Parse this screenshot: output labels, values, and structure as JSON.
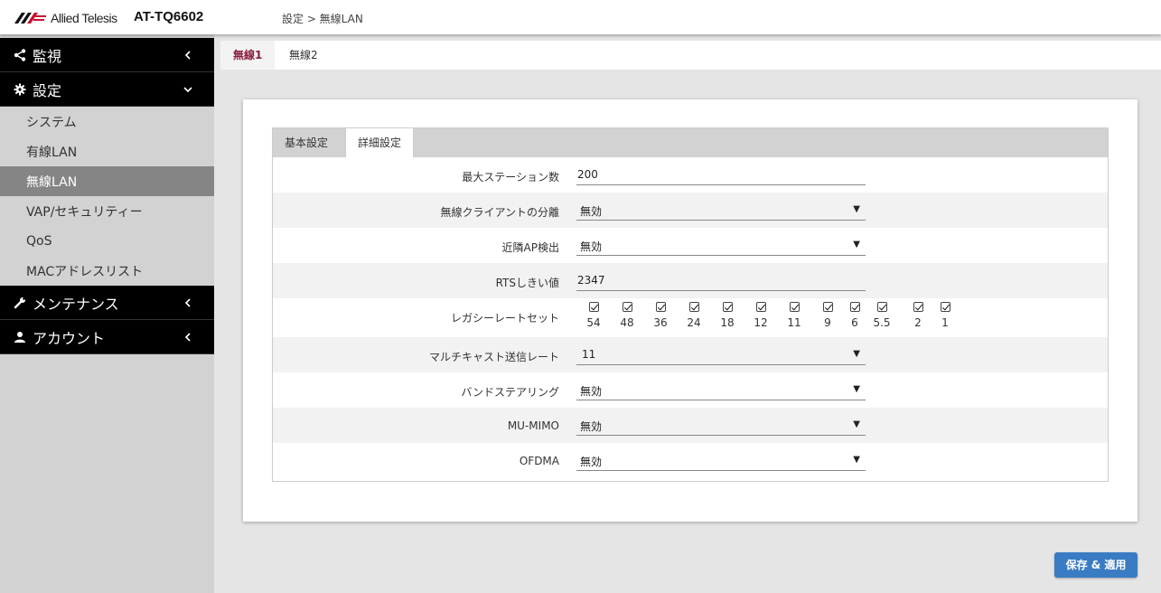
{
  "header": {
    "logo_text": "Allied Telesis",
    "model": "AT-TQ6602",
    "breadcrumb": "設定 > 無線LAN"
  },
  "sidebar": {
    "groups": [
      {
        "label": "監視",
        "icon": "share-icon",
        "chevron": "chevron-left-icon"
      },
      {
        "label": "設定",
        "icon": "gear-icon",
        "chevron": "chevron-down-icon"
      },
      {
        "label": "メンテナンス",
        "icon": "wrench-icon",
        "chevron": "chevron-left-icon"
      },
      {
        "label": "アカウント",
        "icon": "user-icon",
        "chevron": "chevron-left-icon"
      }
    ],
    "settings_items": [
      "システム",
      "有線LAN",
      "無線LAN",
      "VAP/セキュリティー",
      "QoS",
      "MACアドレスリスト"
    ],
    "active_item": "無線LAN"
  },
  "top_tabs": [
    "無線1",
    "無線2"
  ],
  "inner_tabs": [
    "基本設定",
    "詳細設定"
  ],
  "form": {
    "max_stations": {
      "label": "最大ステーション数",
      "value": "200"
    },
    "client_isolation": {
      "label": "無線クライアントの分離",
      "value": "無効"
    },
    "neighbor_ap": {
      "label": "近隣AP検出",
      "value": "無効"
    },
    "rts": {
      "label": "RTSしきい値",
      "value": "2347"
    },
    "legacy_rates": {
      "label": "レガシーレートセット",
      "rates": [
        "54",
        "48",
        "36",
        "24",
        "18",
        "12",
        "11",
        "9",
        "6",
        "5.5",
        "2",
        "1"
      ],
      "checked": [
        true,
        true,
        true,
        true,
        true,
        true,
        true,
        true,
        true,
        true,
        true,
        true
      ]
    },
    "multicast_rate": {
      "label": "マルチキャスト送信レート",
      "value": "11"
    },
    "band_steering": {
      "label": "バンドステアリング",
      "value": "無効"
    },
    "mu_mimo": {
      "label": "MU-MIMO",
      "value": "無効"
    },
    "ofdma": {
      "label": "OFDMA",
      "value": "無効"
    }
  },
  "save_button": "保存 & 適用",
  "colors": {
    "brand_red": "#c8102e",
    "active_tab": "#8b1c3c",
    "button_blue": "#3a7cc3"
  }
}
